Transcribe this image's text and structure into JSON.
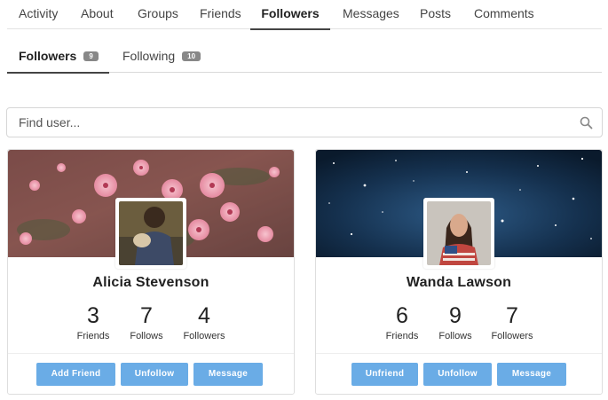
{
  "nav": {
    "tabs": [
      {
        "label": "Activity"
      },
      {
        "label": "About"
      },
      {
        "label": "Groups"
      },
      {
        "label": "Friends"
      },
      {
        "label": "Followers"
      },
      {
        "label": "Messages"
      },
      {
        "label": "Posts"
      },
      {
        "label": "Comments"
      }
    ],
    "active": "Followers"
  },
  "subnav": {
    "tabs": [
      {
        "label": "Followers",
        "count": "9"
      },
      {
        "label": "Following",
        "count": "10"
      }
    ],
    "active": "Followers"
  },
  "search": {
    "placeholder": "Find user...",
    "icon": "search-icon"
  },
  "cards": [
    {
      "name": "Alicia Stevenson",
      "cover": "pink-flowers-cover",
      "stats": [
        {
          "value": "3",
          "label": "Friends"
        },
        {
          "value": "7",
          "label": "Follows"
        },
        {
          "value": "4",
          "label": "Followers"
        }
      ],
      "buttons": [
        {
          "label": "Add Friend"
        },
        {
          "label": "Unfollow"
        },
        {
          "label": "Message"
        }
      ]
    },
    {
      "name": "Wanda Lawson",
      "cover": "starry-night-cover",
      "stats": [
        {
          "value": "6",
          "label": "Friends"
        },
        {
          "value": "9",
          "label": "Follows"
        },
        {
          "value": "7",
          "label": "Followers"
        }
      ],
      "buttons": [
        {
          "label": "Unfriend"
        },
        {
          "label": "Unfollow"
        },
        {
          "label": "Message"
        }
      ]
    }
  ],
  "colors": {
    "button": "#6aace6",
    "badge": "#888888",
    "active_underline": "#444444"
  }
}
